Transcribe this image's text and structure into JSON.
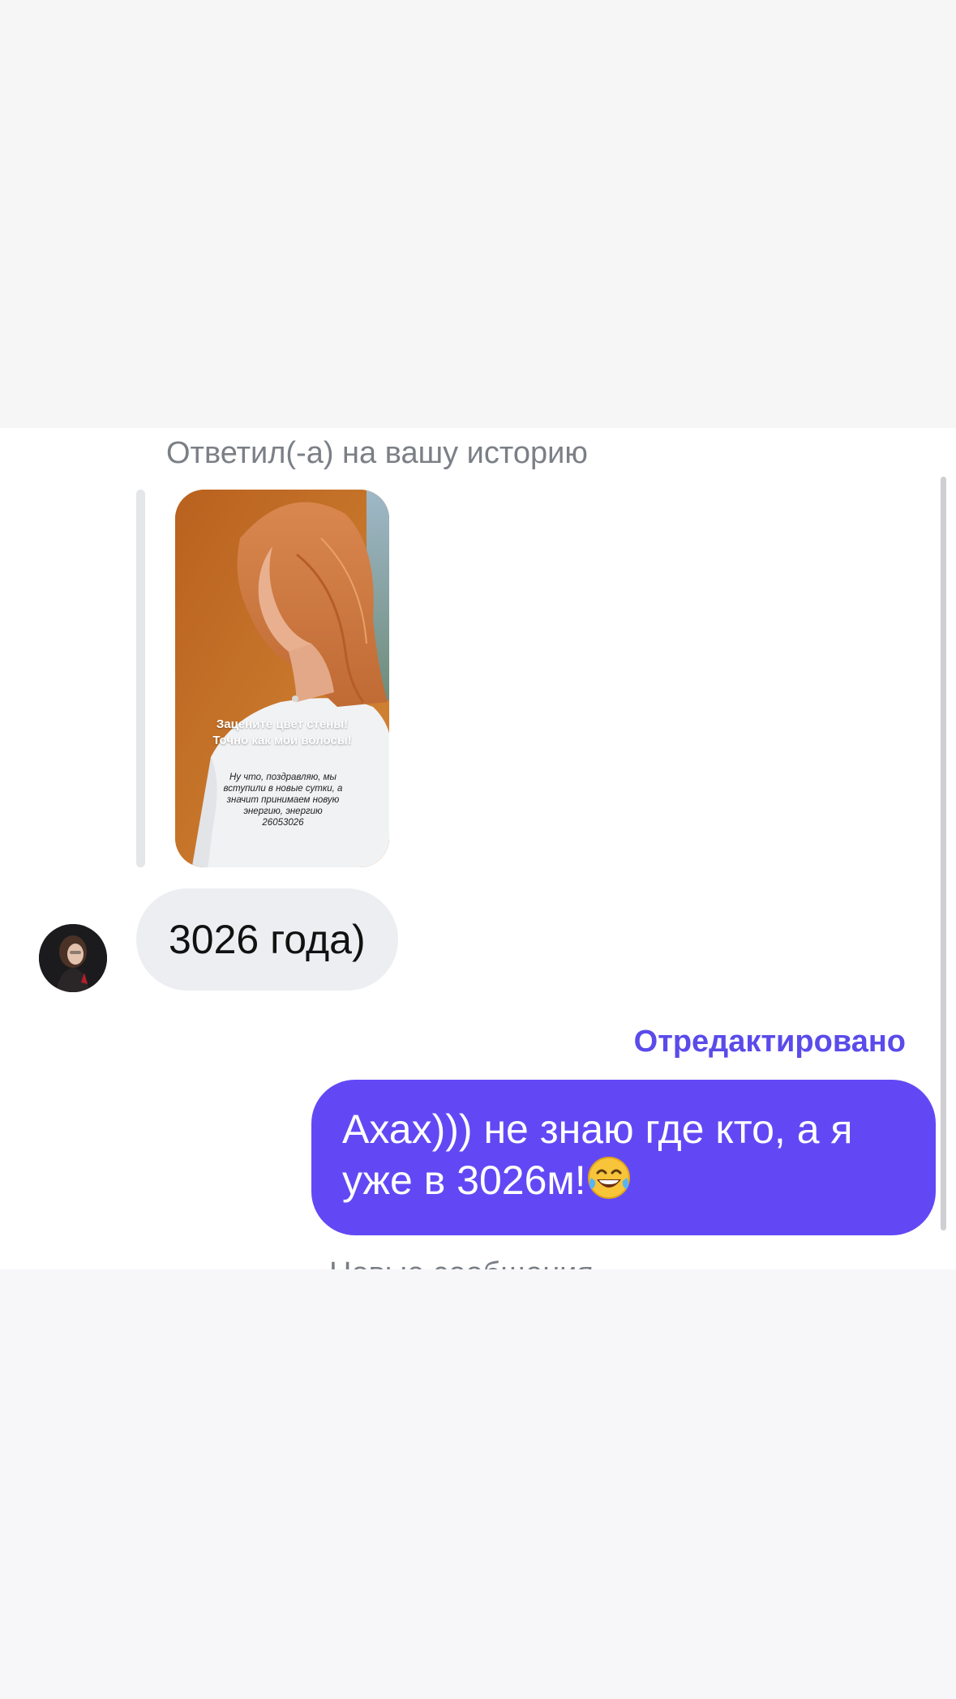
{
  "story_reply": {
    "caption": "Ответил(-а) на вашу историю",
    "headline_line1": "Зацените цвет стены!",
    "headline_line2": "Точно как мои волосы!",
    "body_line1": "Ну что, поздравляю, мы",
    "body_line2": "вступили в новые сутки, а",
    "body_line3": "значит принимаем новую",
    "body_line4": "энергию, энергию",
    "body_line5": "26053026"
  },
  "incoming_message": {
    "text": "3026 года)"
  },
  "outgoing_message": {
    "edited_label": "Отредактировано",
    "line1": "Ахах))) не знаю где кто, а я",
    "line2": "уже в 3026м!",
    "emoji": "laughing-with-tears-emoji"
  },
  "new_messages_divider": "Новые сообщения",
  "colors": {
    "accent": "#6248f5",
    "edited_label": "#5a4bea",
    "incoming_bubble": "#eceef1",
    "caption_gray": "#7b7f86"
  }
}
